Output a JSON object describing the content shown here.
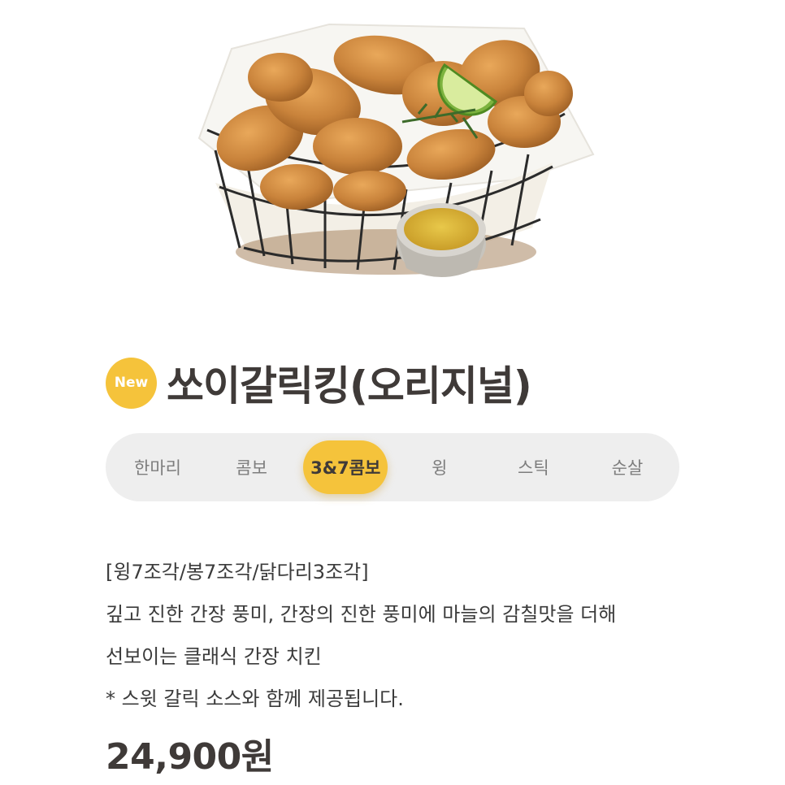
{
  "hero": {
    "image_name": "chicken-basket-photo"
  },
  "badge": {
    "label": "New"
  },
  "product": {
    "name": "쏘이갈릭킹(오리지널)"
  },
  "tabs": [
    {
      "label": "한마리",
      "active": false
    },
    {
      "label": "콤보",
      "active": false
    },
    {
      "label": "3&7콤보",
      "active": true
    },
    {
      "label": "윙",
      "active": false
    },
    {
      "label": "스틱",
      "active": false
    },
    {
      "label": "순살",
      "active": false
    }
  ],
  "description": {
    "line1": "[윙7조각/봉7조각/닭다리3조각]",
    "line2": "깊고 진한 간장 풍미, 간장의 진한 풍미에 마늘의 감칠맛을 더해",
    "line3": "선보이는 클래식 간장 치킨",
    "line4": "* 스윗 갈릭 소스와 함께 제공됩니다."
  },
  "price": "24,900원",
  "colors": {
    "accent": "#f5c33b",
    "text": "#3f3a38",
    "tab_background": "#eeeeee"
  }
}
